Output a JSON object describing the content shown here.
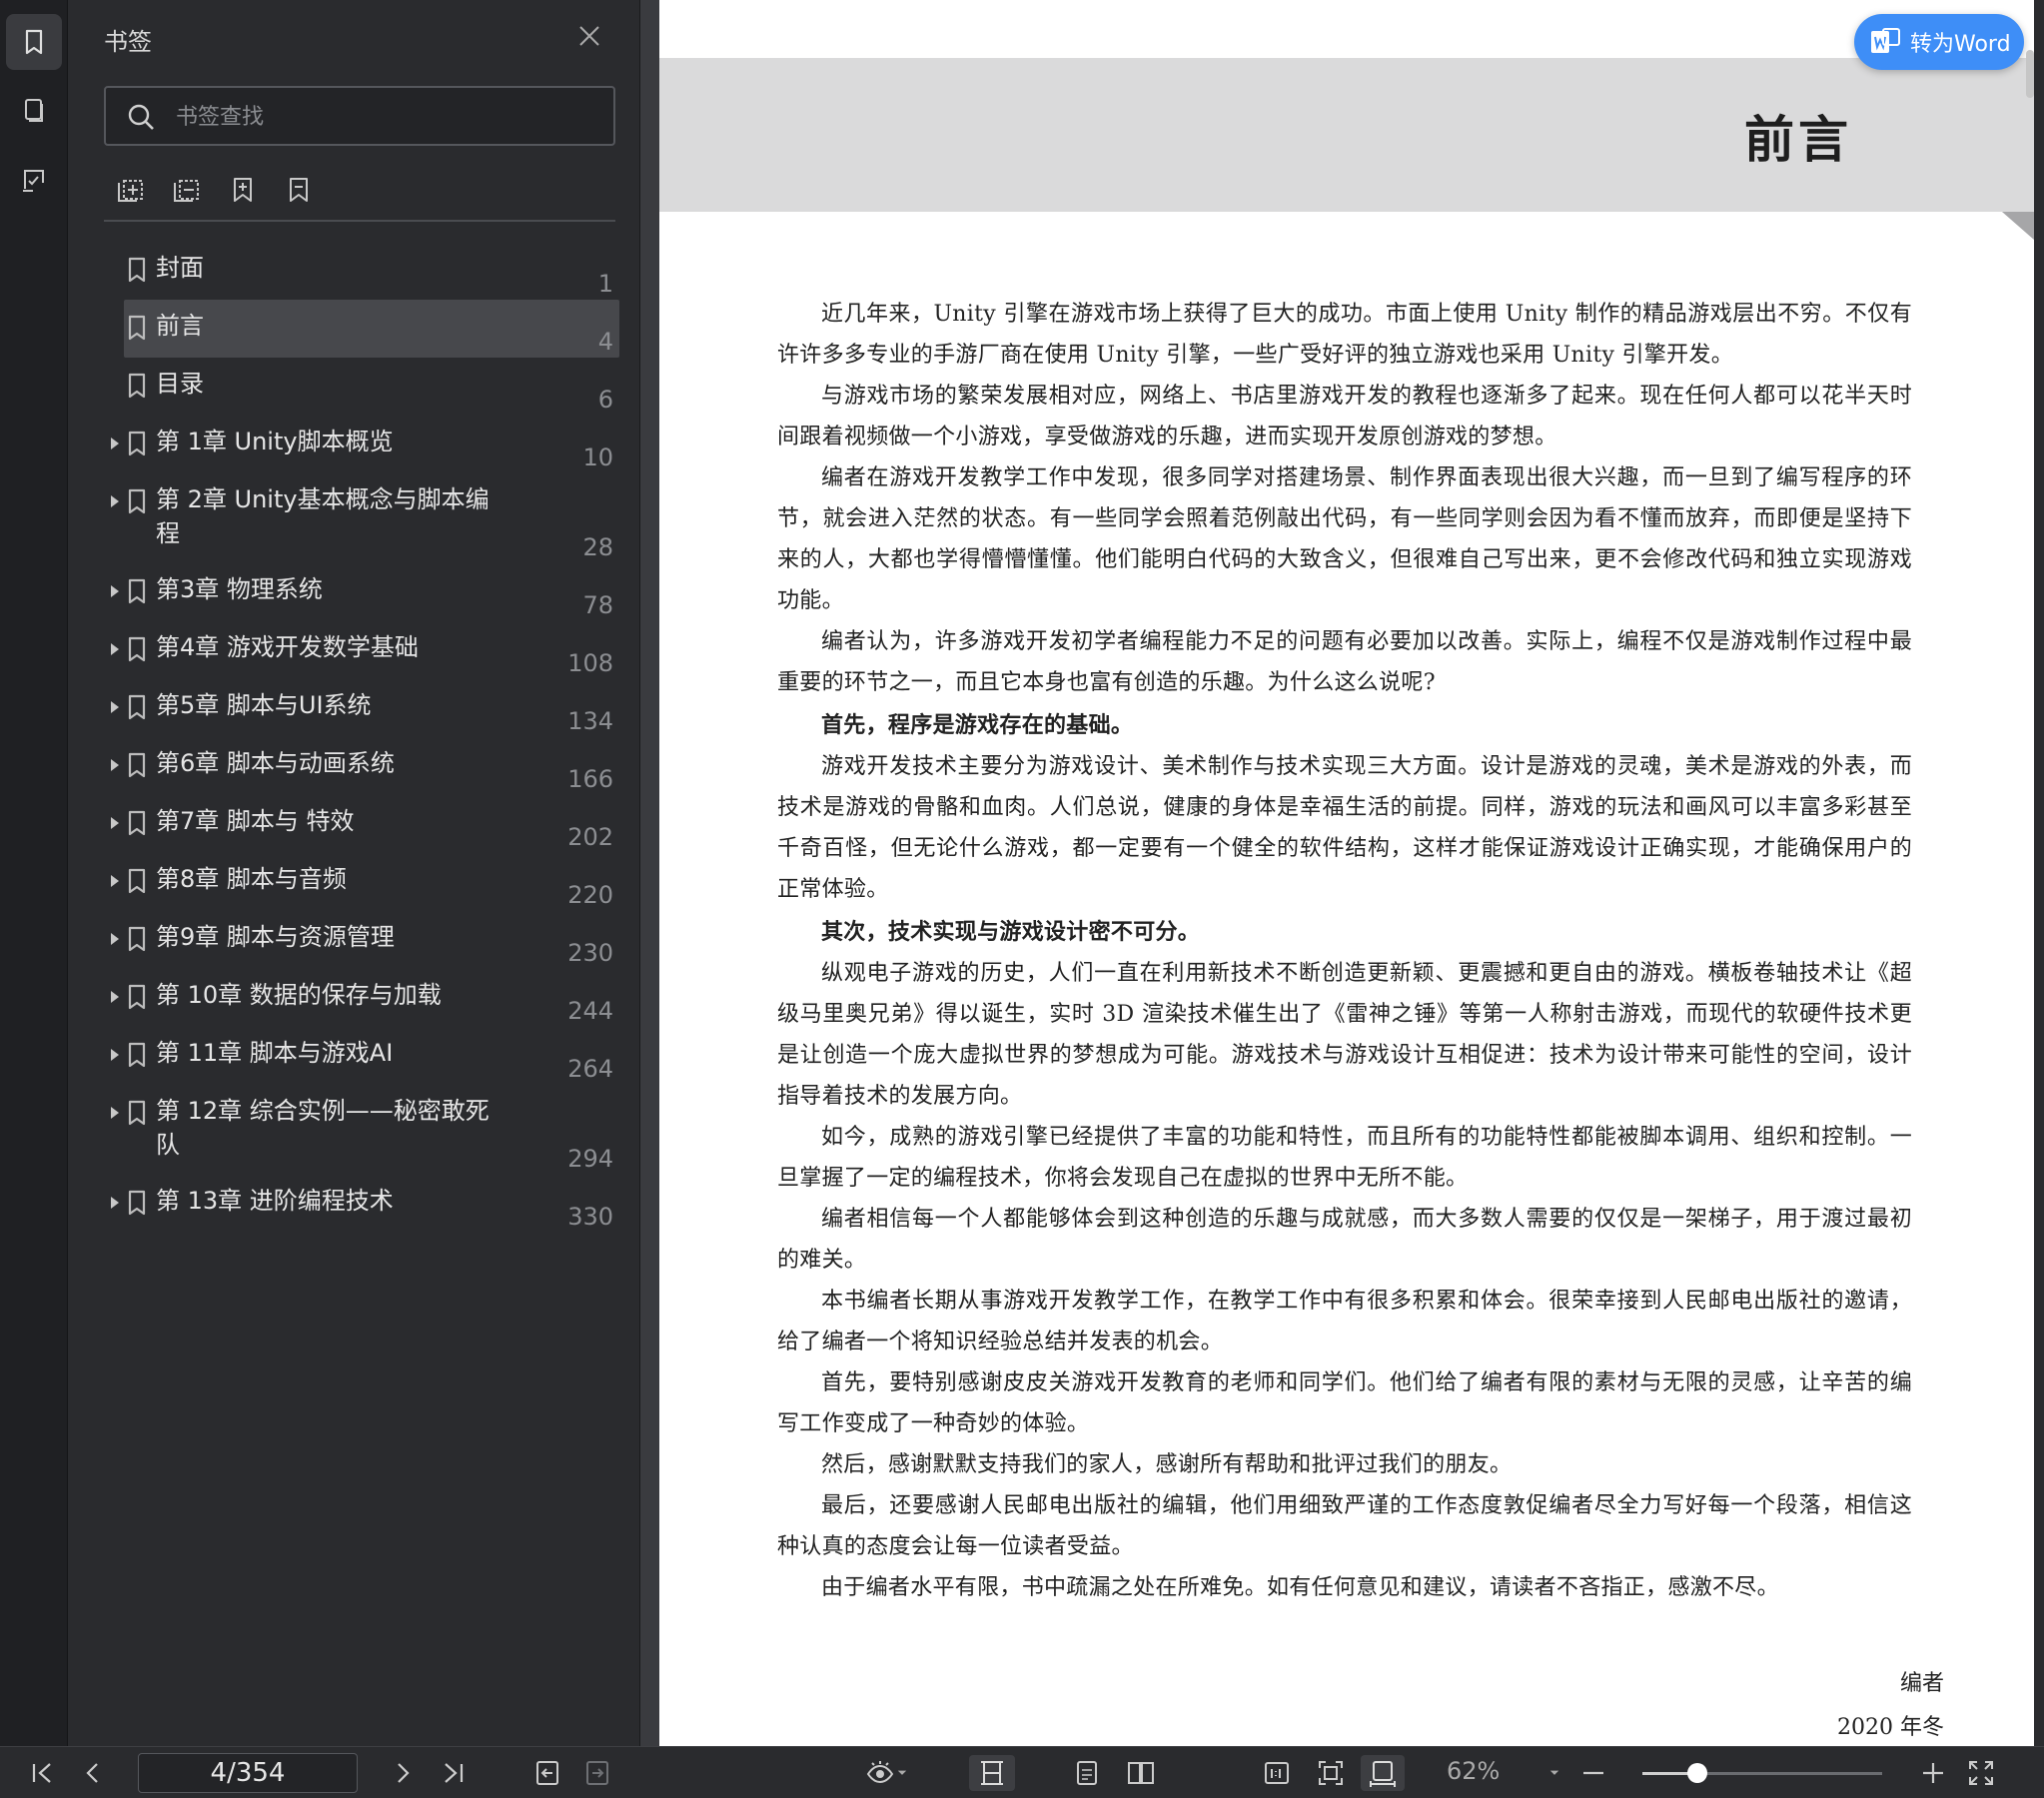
{
  "panel": {
    "title": "书签",
    "search_placeholder": "书签查找"
  },
  "bookmarks": [
    {
      "label": "封面",
      "page": "1",
      "expandable": false,
      "selected": false
    },
    {
      "label": "前言",
      "page": "4",
      "expandable": false,
      "selected": true
    },
    {
      "label": "目录",
      "page": "6",
      "expandable": false,
      "selected": false
    },
    {
      "label": "第 1章 Unity脚本概览",
      "page": "10",
      "expandable": true,
      "selected": false
    },
    {
      "label": "第 2章 Unity基本概念与脚本编程",
      "page": "28",
      "expandable": true,
      "selected": false
    },
    {
      "label": "第3章 物理系统",
      "page": "78",
      "expandable": true,
      "selected": false
    },
    {
      "label": "第4章 游戏开发数学基础",
      "page": "108",
      "expandable": true,
      "selected": false
    },
    {
      "label": "第5章 脚本与UI系统",
      "page": "134",
      "expandable": true,
      "selected": false
    },
    {
      "label": "第6章 脚本与动画系统",
      "page": "166",
      "expandable": true,
      "selected": false
    },
    {
      "label": "第7章 脚本与 特效",
      "page": "202",
      "expandable": true,
      "selected": false
    },
    {
      "label": "第8章 脚本与音频",
      "page": "220",
      "expandable": true,
      "selected": false
    },
    {
      "label": "第9章 脚本与资源管理",
      "page": "230",
      "expandable": true,
      "selected": false
    },
    {
      "label": "第 10章 数据的保存与加载",
      "page": "244",
      "expandable": true,
      "selected": false
    },
    {
      "label": "第 11章 脚本与游戏AI",
      "page": "264",
      "expandable": true,
      "selected": false
    },
    {
      "label": "第 12章 综合实例——秘密敢死队",
      "page": "294",
      "expandable": true,
      "selected": false
    },
    {
      "label": "第 13章 进阶编程技术",
      "page": "330",
      "expandable": true,
      "selected": false
    }
  ],
  "viewer": {
    "convert_label": "转为Word",
    "page_title": "前言",
    "paragraphs": [
      {
        "text": "近几年来，Unity 引擎在游戏市场上获得了巨大的成功。市面上使用 Unity 制作的精品游戏层出不穷。不仅有许许多多专业的手游厂商在使用 Unity 引擎，一些广受好评的独立游戏也采用 Unity 引擎开发。",
        "bold": false
      },
      {
        "text": "与游戏市场的繁荣发展相对应，网络上、书店里游戏开发的教程也逐渐多了起来。现在任何人都可以花半天时间跟着视频做一个小游戏，享受做游戏的乐趣，进而实现开发原创游戏的梦想。",
        "bold": false
      },
      {
        "text": "编者在游戏开发教学工作中发现，很多同学对搭建场景、制作界面表现出很大兴趣，而一旦到了编写程序的环节，就会进入茫然的状态。有一些同学会照着范例敲出代码，有一些同学则会因为看不懂而放弃，而即便是坚持下来的人，大都也学得懵懵懂懂。他们能明白代码的大致含义，但很难自己写出来，更不会修改代码和独立实现游戏功能。",
        "bold": false
      },
      {
        "text": "编者认为，许多游戏开发初学者编程能力不足的问题有必要加以改善。实际上，编程不仅是游戏制作过程中最重要的环节之一，而且它本身也富有创造的乐趣。为什么这么说呢?",
        "bold": false
      },
      {
        "text": "首先，程序是游戏存在的基础。",
        "bold": true
      },
      {
        "text": "游戏开发技术主要分为游戏设计、美术制作与技术实现三大方面。设计是游戏的灵魂，美术是游戏的外表，而技术是游戏的骨骼和血肉。人们总说，健康的身体是幸福生活的前提。同样，游戏的玩法和画风可以丰富多彩甚至千奇百怪，但无论什么游戏，都一定要有一个健全的软件结构，这样才能保证游戏设计正确实现，才能确保用户的正常体验。",
        "bold": false
      },
      {
        "text": "其次，技术实现与游戏设计密不可分。",
        "bold": true
      },
      {
        "text": "纵观电子游戏的历史，人们一直在利用新技术不断创造更新颖、更震撼和更自由的游戏。横板卷轴技术让《超级马里奥兄弟》得以诞生，实时 3D 渲染技术催生出了《雷神之锤》等第一人称射击游戏，而现代的软硬件技术更是让创造一个庞大虚拟世界的梦想成为可能。游戏技术与游戏设计互相促进：技术为设计带来可能性的空间，设计指导着技术的发展方向。",
        "bold": false
      },
      {
        "text": "如今，成熟的游戏引擎已经提供了丰富的功能和特性，而且所有的功能特性都能被脚本调用、组织和控制。一旦掌握了一定的编程技术，你将会发现自己在虚拟的世界中无所不能。",
        "bold": false
      },
      {
        "text": "编者相信每一个人都能够体会到这种创造的乐趣与成就感，而大多数人需要的仅仅是一架梯子，用于渡过最初的难关。",
        "bold": false
      },
      {
        "text": "本书编者长期从事游戏开发教学工作，在教学工作中有很多积累和体会。很荣幸接到人民邮电出版社的邀请，给了编者一个将知识经验总结并发表的机会。",
        "bold": false
      },
      {
        "text": "首先，要特别感谢皮皮关游戏开发教育的老师和同学们。他们给了编者有限的素材与无限的灵感，让辛苦的编写工作变成了一种奇妙的体验。",
        "bold": false
      },
      {
        "text": "然后，感谢默默支持我们的家人，感谢所有帮助和批评过我们的朋友。",
        "bold": false
      },
      {
        "text": "最后，还要感谢人民邮电出版社的编辑，他们用细致严谨的工作态度敦促编者尽全力写好每一个段落，相信这种认真的态度会让每一位读者受益。",
        "bold": false
      },
      {
        "text": "由于编者水平有限，书中疏漏之处在所难免。如有任何意见和建议，请读者不吝指正，感激不尽。",
        "bold": false
      }
    ],
    "signature_author": "编者",
    "signature_date": "2020 年冬"
  },
  "toolbar": {
    "page_indicator": "4/354",
    "zoom_label": "62%",
    "zoom_fraction": 0.23
  },
  "colors": {
    "accent": "#3e8ef7",
    "panel_bg": "#2a2b2e",
    "rail_bg": "#1f2023",
    "selected_row": "#47484c"
  }
}
